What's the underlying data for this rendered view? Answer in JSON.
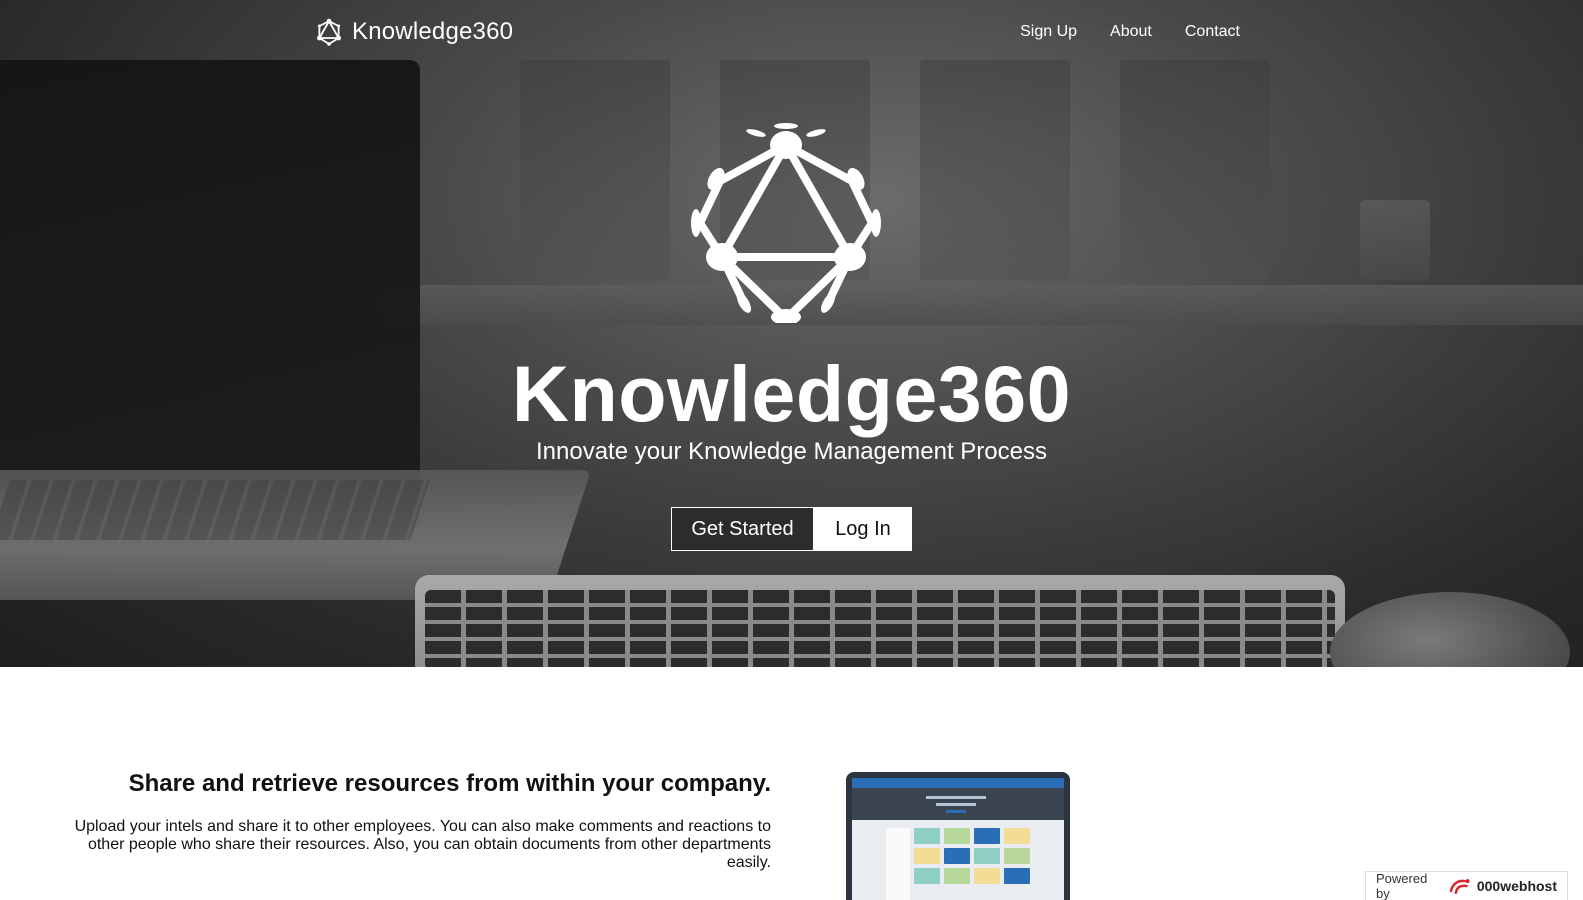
{
  "nav": {
    "brand": "Knowledge360",
    "links": [
      {
        "label": "Sign Up"
      },
      {
        "label": "About"
      },
      {
        "label": "Contact"
      }
    ]
  },
  "hero": {
    "title": "Knowledge360",
    "subtitle": "Innovate your Knowledge Management Process",
    "primary_button": "Get Started",
    "secondary_button": "Log In"
  },
  "feature": {
    "title": "Share and retrieve resources from within your company.",
    "text": "Upload your intels and share it to other employees. You can also make comments and reactions to other people who share their resources. Also, you can obtain documents from other departments easily."
  },
  "footer_badge": {
    "prefix": "Powered by",
    "brand": "000webhost"
  },
  "icons": {
    "brand_logo": "network-sphere-icon",
    "hero_logo": "network-sphere-icon",
    "badge_logo": "000webhost-icon"
  },
  "colors": {
    "hero_text": "#ffffff",
    "primary_button_bg": "#2c2c2c",
    "secondary_button_bg": "#ffffff",
    "body_text": "#111111"
  }
}
